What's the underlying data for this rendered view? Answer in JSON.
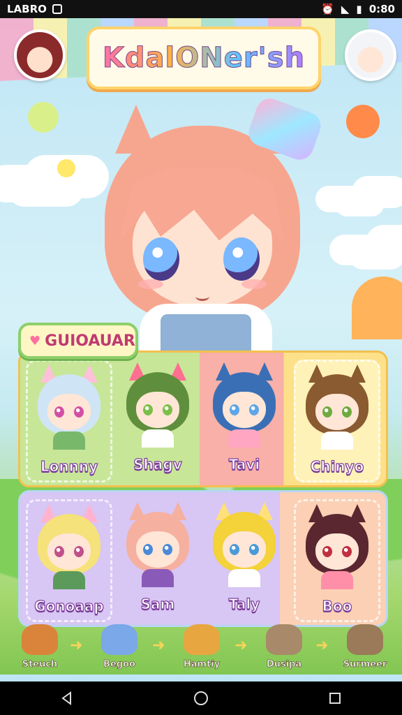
{
  "status_bar": {
    "carrier": "LABRO",
    "time": "0:80"
  },
  "header": {
    "title": "KdalONer'sh"
  },
  "section": {
    "label": "GUIOAUAR"
  },
  "characters": [
    {
      "name": "Lonnny",
      "hair": "#cfe5f5",
      "eye": "#d24fa6",
      "shirt": "#78b86a",
      "ears": "#ffc1d9"
    },
    {
      "name": "Shagv",
      "hair": "#5f8f3c",
      "eye": "#7bbf4a",
      "shirt": "#ffffff",
      "ears": "#ff6f91"
    },
    {
      "name": "Tavi",
      "hair": "#3a6fb5",
      "eye": "#5ea6e8",
      "shirt": "#ffa6c2",
      "ears": "#3a6fb5"
    },
    {
      "name": "Chinyo",
      "hair": "#8a5a30",
      "eye": "#6faa40",
      "shirt": "#ffffff",
      "ears": "#8a5a30"
    },
    {
      "name": "Gonoaap",
      "hair": "#f5e27a",
      "eye": "#c0508a",
      "shirt": "#5c9a5c",
      "ears": "#ffb3cf"
    },
    {
      "name": "Sam",
      "hair": "#f5b0a0",
      "eye": "#4a8ad8",
      "shirt": "#8a5ab8",
      "ears": "#f5b0a0"
    },
    {
      "name": "Taly",
      "hair": "#f3d23a",
      "eye": "#4a9ad8",
      "shirt": "#ffffff",
      "ears": "#ffe07a"
    },
    {
      "name": "Boo",
      "hair": "#5a2730",
      "eye": "#c03040",
      "shirt": "#ff8fa8",
      "ears": "#5a2730"
    }
  ],
  "pets": [
    {
      "label": "Steuch",
      "color": "#d9843a"
    },
    {
      "label": "Begoo",
      "color": "#7aa8e8"
    },
    {
      "label": "Hamtiy",
      "color": "#e8a640"
    },
    {
      "label": "Dusipa",
      "color": "#a88a6a"
    },
    {
      "label": "Surmeer",
      "color": "#9a7a58"
    }
  ],
  "colors": {
    "accent_pink": "#ff6fa8",
    "panel_border_gold": "#f2c14e",
    "section_border_green": "#8dcf6a"
  },
  "icons": [
    "signal-icon",
    "wifi-icon",
    "battery-icon",
    "alarm-icon",
    "back-icon",
    "home-icon",
    "recents-icon"
  ]
}
